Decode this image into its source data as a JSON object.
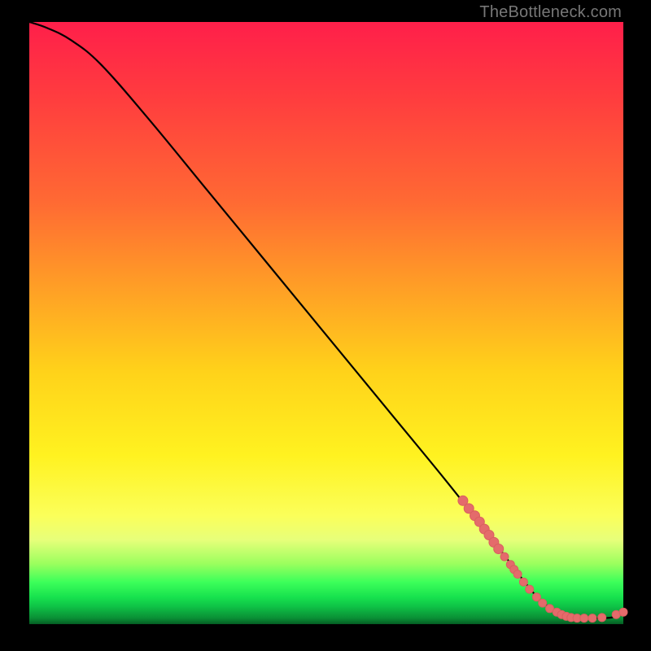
{
  "watermark": "TheBottleneck.com",
  "colors": {
    "background": "#000000",
    "curve": "#000000",
    "points": "#e46b6b",
    "gradient_top": "#ff1f4a",
    "gradient_bottom": "#055d23"
  },
  "chart_data": {
    "type": "line",
    "title": "",
    "xlabel": "",
    "ylabel": "",
    "xlim": [
      0,
      100
    ],
    "ylim": [
      0,
      100
    ],
    "series": [
      {
        "name": "bottleneck-curve",
        "x": [
          0,
          3,
          7,
          12,
          20,
          30,
          40,
          50,
          60,
          70,
          78,
          83,
          86,
          89,
          92,
          95,
          98,
          100
        ],
        "y": [
          100,
          99,
          97,
          93,
          84,
          72,
          60,
          48,
          36,
          24,
          14,
          7.5,
          4,
          2,
          1.2,
          1.0,
          1.1,
          1.8
        ]
      }
    ],
    "points_overlay": [
      {
        "x": 73.0,
        "y": 20.5,
        "r": 6
      },
      {
        "x": 74.0,
        "y": 19.2,
        "r": 6
      },
      {
        "x": 75.0,
        "y": 18.0,
        "r": 6
      },
      {
        "x": 75.8,
        "y": 17.0,
        "r": 6
      },
      {
        "x": 76.6,
        "y": 15.8,
        "r": 6
      },
      {
        "x": 77.4,
        "y": 14.8,
        "r": 6
      },
      {
        "x": 78.2,
        "y": 13.6,
        "r": 6
      },
      {
        "x": 79.0,
        "y": 12.5,
        "r": 6
      },
      {
        "x": 80.0,
        "y": 11.2,
        "r": 5
      },
      {
        "x": 81.0,
        "y": 9.9,
        "r": 5
      },
      {
        "x": 81.6,
        "y": 9.1,
        "r": 5
      },
      {
        "x": 82.2,
        "y": 8.3,
        "r": 5
      },
      {
        "x": 83.2,
        "y": 7.0,
        "r": 5
      },
      {
        "x": 84.2,
        "y": 5.8,
        "r": 5
      },
      {
        "x": 85.4,
        "y": 4.5,
        "r": 5
      },
      {
        "x": 86.4,
        "y": 3.5,
        "r": 5
      },
      {
        "x": 87.6,
        "y": 2.6,
        "r": 5
      },
      {
        "x": 88.8,
        "y": 2.0,
        "r": 5
      },
      {
        "x": 89.6,
        "y": 1.6,
        "r": 5
      },
      {
        "x": 90.4,
        "y": 1.3,
        "r": 5
      },
      {
        "x": 91.2,
        "y": 1.1,
        "r": 5
      },
      {
        "x": 92.2,
        "y": 1.0,
        "r": 5
      },
      {
        "x": 93.4,
        "y": 1.0,
        "r": 5
      },
      {
        "x": 94.8,
        "y": 1.0,
        "r": 5
      },
      {
        "x": 96.4,
        "y": 1.1,
        "r": 5
      },
      {
        "x": 98.8,
        "y": 1.6,
        "r": 5
      },
      {
        "x": 100.0,
        "y": 2.0,
        "r": 5
      }
    ]
  }
}
